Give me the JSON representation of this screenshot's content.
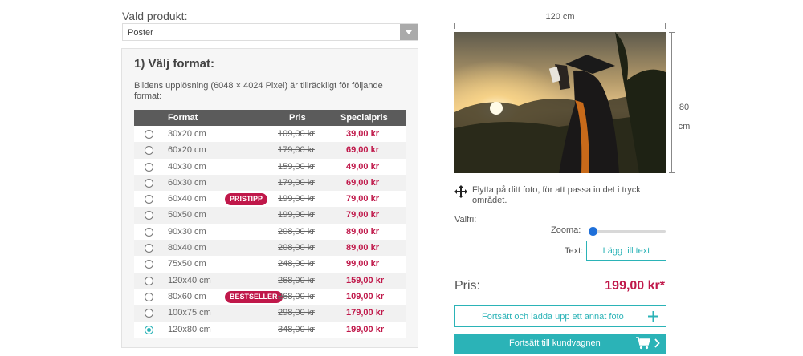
{
  "product": {
    "label": "Vald produkt:",
    "selected": "Poster"
  },
  "format": {
    "title": "1) Välj format:",
    "description": "Bildens upplösning (6048 × 4024 Pixel) är tillräckligt för följande format:",
    "headers": {
      "format": "Format",
      "price": "Pris",
      "special": "Specialpris"
    },
    "rows": [
      {
        "size": "30x20 cm",
        "price": "109,00 kr",
        "special": "39,00 kr",
        "badge": "",
        "selected": false
      },
      {
        "size": "60x20 cm",
        "price": "179,00 kr",
        "special": "69,00 kr",
        "badge": "",
        "selected": false
      },
      {
        "size": "40x30 cm",
        "price": "159,00 kr",
        "special": "49,00 kr",
        "badge": "",
        "selected": false
      },
      {
        "size": "60x30 cm",
        "price": "179,00 kr",
        "special": "69,00 kr",
        "badge": "",
        "selected": false
      },
      {
        "size": "60x40 cm",
        "price": "199,00 kr",
        "special": "79,00 kr",
        "badge": "PRISTIPP",
        "selected": false
      },
      {
        "size": "50x50 cm",
        "price": "199,00 kr",
        "special": "79,00 kr",
        "badge": "",
        "selected": false
      },
      {
        "size": "90x30 cm",
        "price": "208,00 kr",
        "special": "89,00 kr",
        "badge": "",
        "selected": false
      },
      {
        "size": "80x40 cm",
        "price": "208,00 kr",
        "special": "89,00 kr",
        "badge": "",
        "selected": false
      },
      {
        "size": "75x50 cm",
        "price": "248,00 kr",
        "special": "99,00 kr",
        "badge": "",
        "selected": false
      },
      {
        "size": "120x40 cm",
        "price": "268,00 kr",
        "special": "159,00 kr",
        "badge": "",
        "selected": false
      },
      {
        "size": "80x60 cm",
        "price": "268,00 kr",
        "special": "109,00 kr",
        "badge": "BESTSELLER",
        "selected": false
      },
      {
        "size": "100x75 cm",
        "price": "298,00 kr",
        "special": "179,00 kr",
        "badge": "",
        "selected": false
      },
      {
        "size": "120x80 cm",
        "price": "348,00 kr",
        "special": "199,00 kr",
        "badge": "",
        "selected": true
      }
    ]
  },
  "preview": {
    "width_label": "120 cm",
    "height_value": "80",
    "height_unit": "cm",
    "move_hint": "Flytta på ditt foto, för att passa in det i tryck området.",
    "move_icon": "move-arrows-icon"
  },
  "options": {
    "optional_label": "Valfri:",
    "zoom_label": "Zooma:",
    "zoom_level": 0.0,
    "text_label": "Text:",
    "add_text_button": "Lägg till text"
  },
  "price": {
    "label": "Pris:",
    "value": "199,00 kr*"
  },
  "actions": {
    "upload_button": "Fortsätt och ladda upp ett annat foto",
    "upload_icon": "plus-icon",
    "cart_button": "Fortsätt till kundvagnen",
    "cart_icon": "cart-icon"
  },
  "colors": {
    "accent": "#2bb3b7",
    "price_red": "#c0184a",
    "header_gray": "#5b5b5b"
  }
}
